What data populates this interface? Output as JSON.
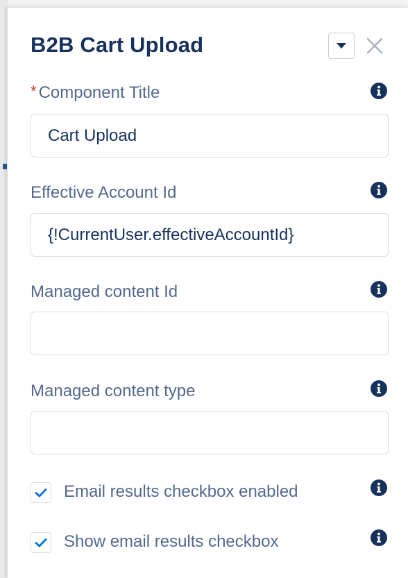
{
  "panel": {
    "title": "B2B Cart Upload",
    "collapse_icon": "chevron-down-icon",
    "close_icon": "close-icon"
  },
  "fields": {
    "component_title": {
      "required_mark": "*",
      "label": "Component Title",
      "value": "Cart Upload"
    },
    "effective_account_id": {
      "label": "Effective Account Id",
      "value": "{!CurrentUser.effectiveAccountId}"
    },
    "managed_content_id": {
      "label": "Managed content Id",
      "value": ""
    },
    "managed_content_type": {
      "label": "Managed content type",
      "value": ""
    }
  },
  "checkboxes": {
    "email_results_enabled": {
      "label": "Email results checkbox enabled",
      "checked": true
    },
    "show_email_results": {
      "label": "Show email results checkbox",
      "checked": true
    }
  },
  "icons": {
    "info": "info-icon",
    "check": "checkmark-icon"
  },
  "colors": {
    "title": "#16325c",
    "label": "#54698d",
    "required": "#c23934",
    "accent": "#0070d2",
    "info_icon": "#16325c"
  }
}
